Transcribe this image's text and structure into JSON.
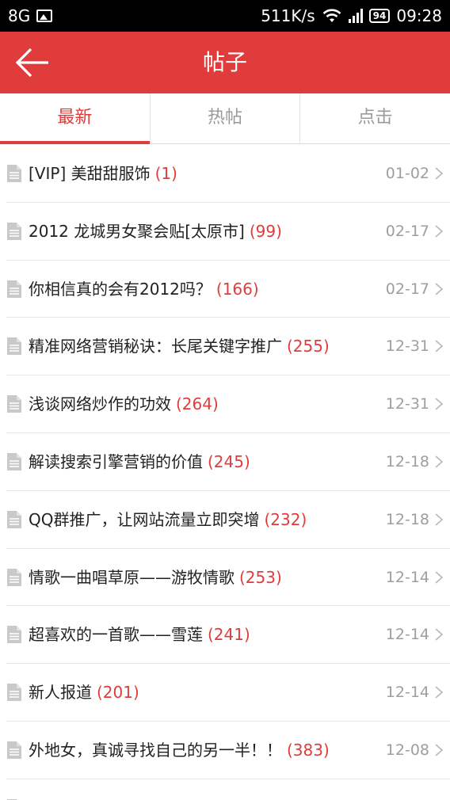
{
  "statusbar": {
    "network": "8G",
    "speed": "511K/s",
    "battery": "94",
    "time": "09:28"
  },
  "header": {
    "title": "帖子",
    "back_icon": "arrow-left-icon",
    "color": "#e03c3c"
  },
  "tabs": [
    {
      "label": "最新",
      "active": true
    },
    {
      "label": "热帖",
      "active": false
    },
    {
      "label": "点击",
      "active": false
    }
  ],
  "posts": [
    {
      "title": "[VIP] 美甜甜服饰",
      "count": "(1)",
      "date": "01-02"
    },
    {
      "title": "2012 龙城男女聚会贴[太原市]",
      "count": "(99)",
      "date": "02-17"
    },
    {
      "title": "你相信真的会有2012吗？",
      "count": "(166)",
      "date": "02-17"
    },
    {
      "title": "精准网络营销秘诀：长尾关键字推广",
      "count": "(255)",
      "date": "12-31"
    },
    {
      "title": "浅谈网络炒作的功效",
      "count": "(264)",
      "date": "12-31"
    },
    {
      "title": "解读搜索引擎营销的价值",
      "count": "(245)",
      "date": "12-18"
    },
    {
      "title": "QQ群推广，让网站流量立即突增",
      "count": "(232)",
      "date": "12-18"
    },
    {
      "title": "情歌一曲唱草原——游牧情歌",
      "count": "(253)",
      "date": "12-14"
    },
    {
      "title": "超喜欢的一首歌——雪莲",
      "count": "(241)",
      "date": "12-14"
    },
    {
      "title": "新人报道",
      "count": "(201)",
      "date": "12-14"
    },
    {
      "title": "外地女，真诚寻找自己的另一半！！",
      "count": "(383)",
      "date": "12-08"
    },
    {
      "title": "",
      "count": "",
      "date": ""
    }
  ]
}
